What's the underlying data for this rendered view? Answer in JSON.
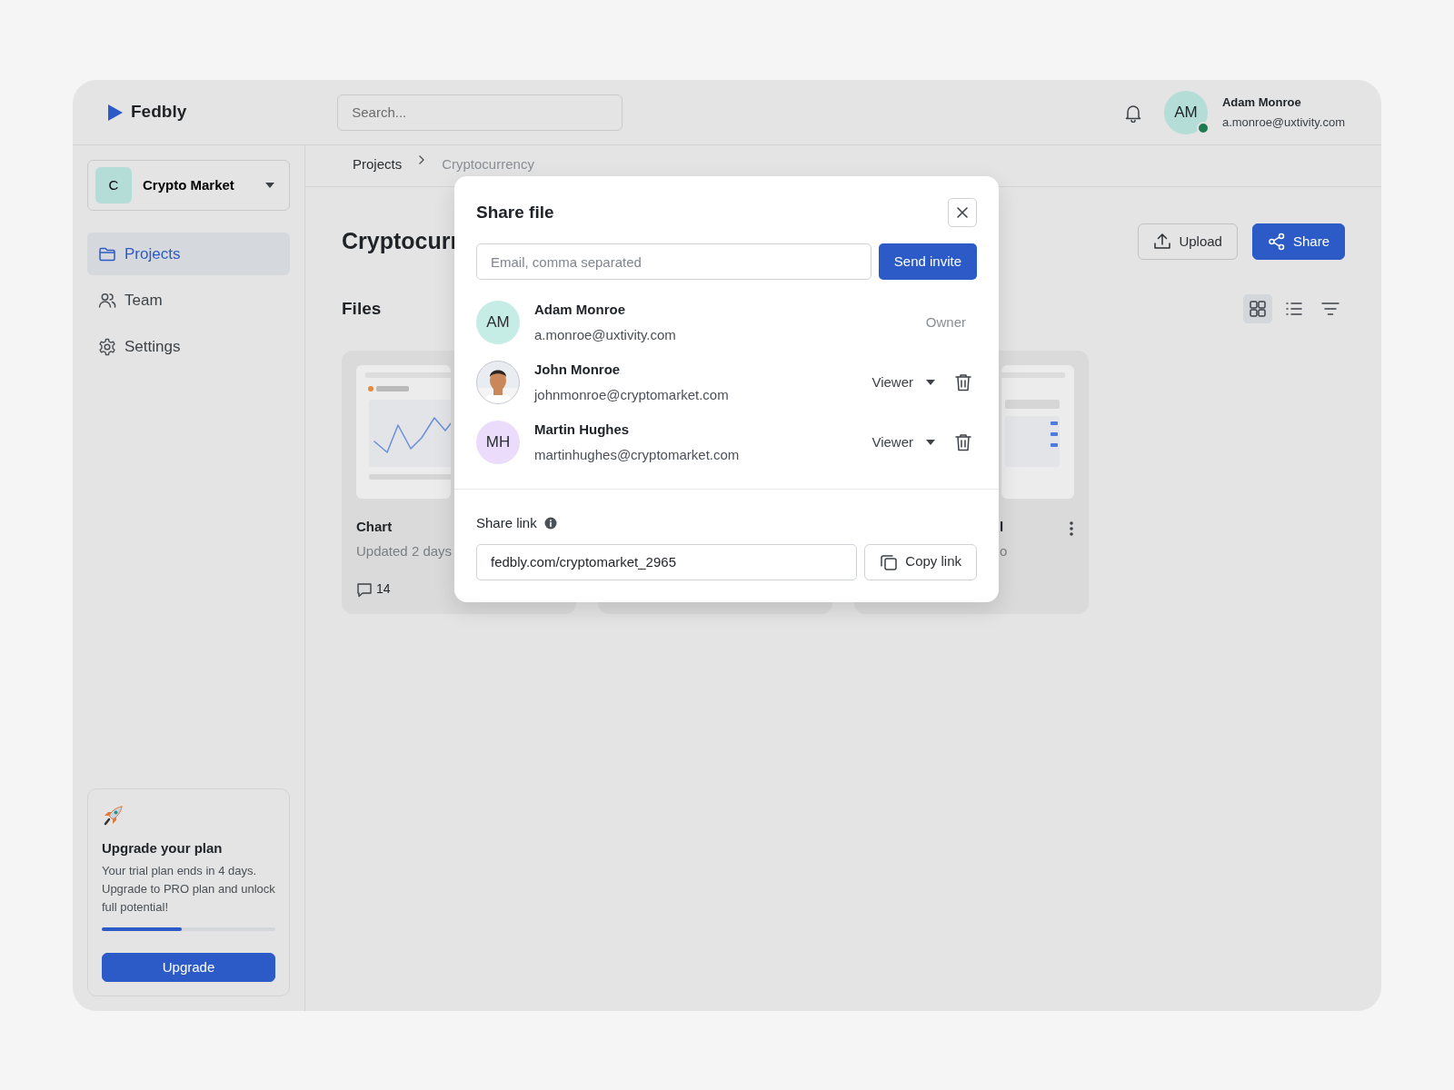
{
  "header": {
    "logo": "Fedbly",
    "search": {
      "placeholder": "Search..."
    },
    "user": {
      "initials": "AM",
      "name": "Adam Monroe",
      "email": "a.monroe@uxtivity.com",
      "online": true
    }
  },
  "sidebar": {
    "workspace": {
      "initial": "C",
      "name": "Crypto Market"
    },
    "items": [
      {
        "label": "Projects",
        "selected": true
      },
      {
        "label": "Team",
        "selected": false
      },
      {
        "label": "Settings",
        "selected": false
      }
    ],
    "upgrade": {
      "title": "Upgrade your plan",
      "text": "Your trial plan ends in 4 days. Upgrade to PRO plan and unlock full potential!",
      "level": 0.46,
      "button": "Upgrade"
    }
  },
  "breadcrumb": [
    "Projects",
    "Cryptocurrency"
  ],
  "page": {
    "title": "Cryptocurr",
    "buttons": [
      {
        "label": "Upload",
        "kind": "secondary"
      },
      {
        "label": "Share",
        "kind": "primary"
      }
    ],
    "section": "Files",
    "views": [
      {
        "selected": true
      },
      {
        "selected": false
      },
      {
        "selected": false
      }
    ]
  },
  "files": [
    {
      "kind": "left",
      "title": "Chart",
      "subtitle": "Updated 2 days",
      "comments": "14"
    },
    {
      "kind": "covered"
    },
    {
      "kind": "right",
      "title": "l",
      "subtitle": "o",
      "menu": true
    }
  ],
  "dialog": {
    "title": "Share file",
    "invite": {
      "placeholder": "Email, comma separated",
      "button": "Send invite"
    },
    "members": [
      {
        "kind": "owner",
        "initials": "AM",
        "color": "#c6ece6",
        "name": "Adam Monroe",
        "email": "a.monroe@uxtivity.com",
        "role": "Owner"
      },
      {
        "kind": "member",
        "name": "John Monroe",
        "email": "johnmonroe@cryptomarket.com",
        "role": "Viewer"
      },
      {
        "kind": "member",
        "initials": "MH",
        "color": "#ebdcfb",
        "name": "Martin Hughes",
        "email": "martinhughes@cryptomarket.com",
        "role": "Viewer"
      }
    ],
    "link": {
      "label": "Share link",
      "value": "fedbly.com/cryptomarket_2965",
      "button": "Copy link"
    }
  }
}
